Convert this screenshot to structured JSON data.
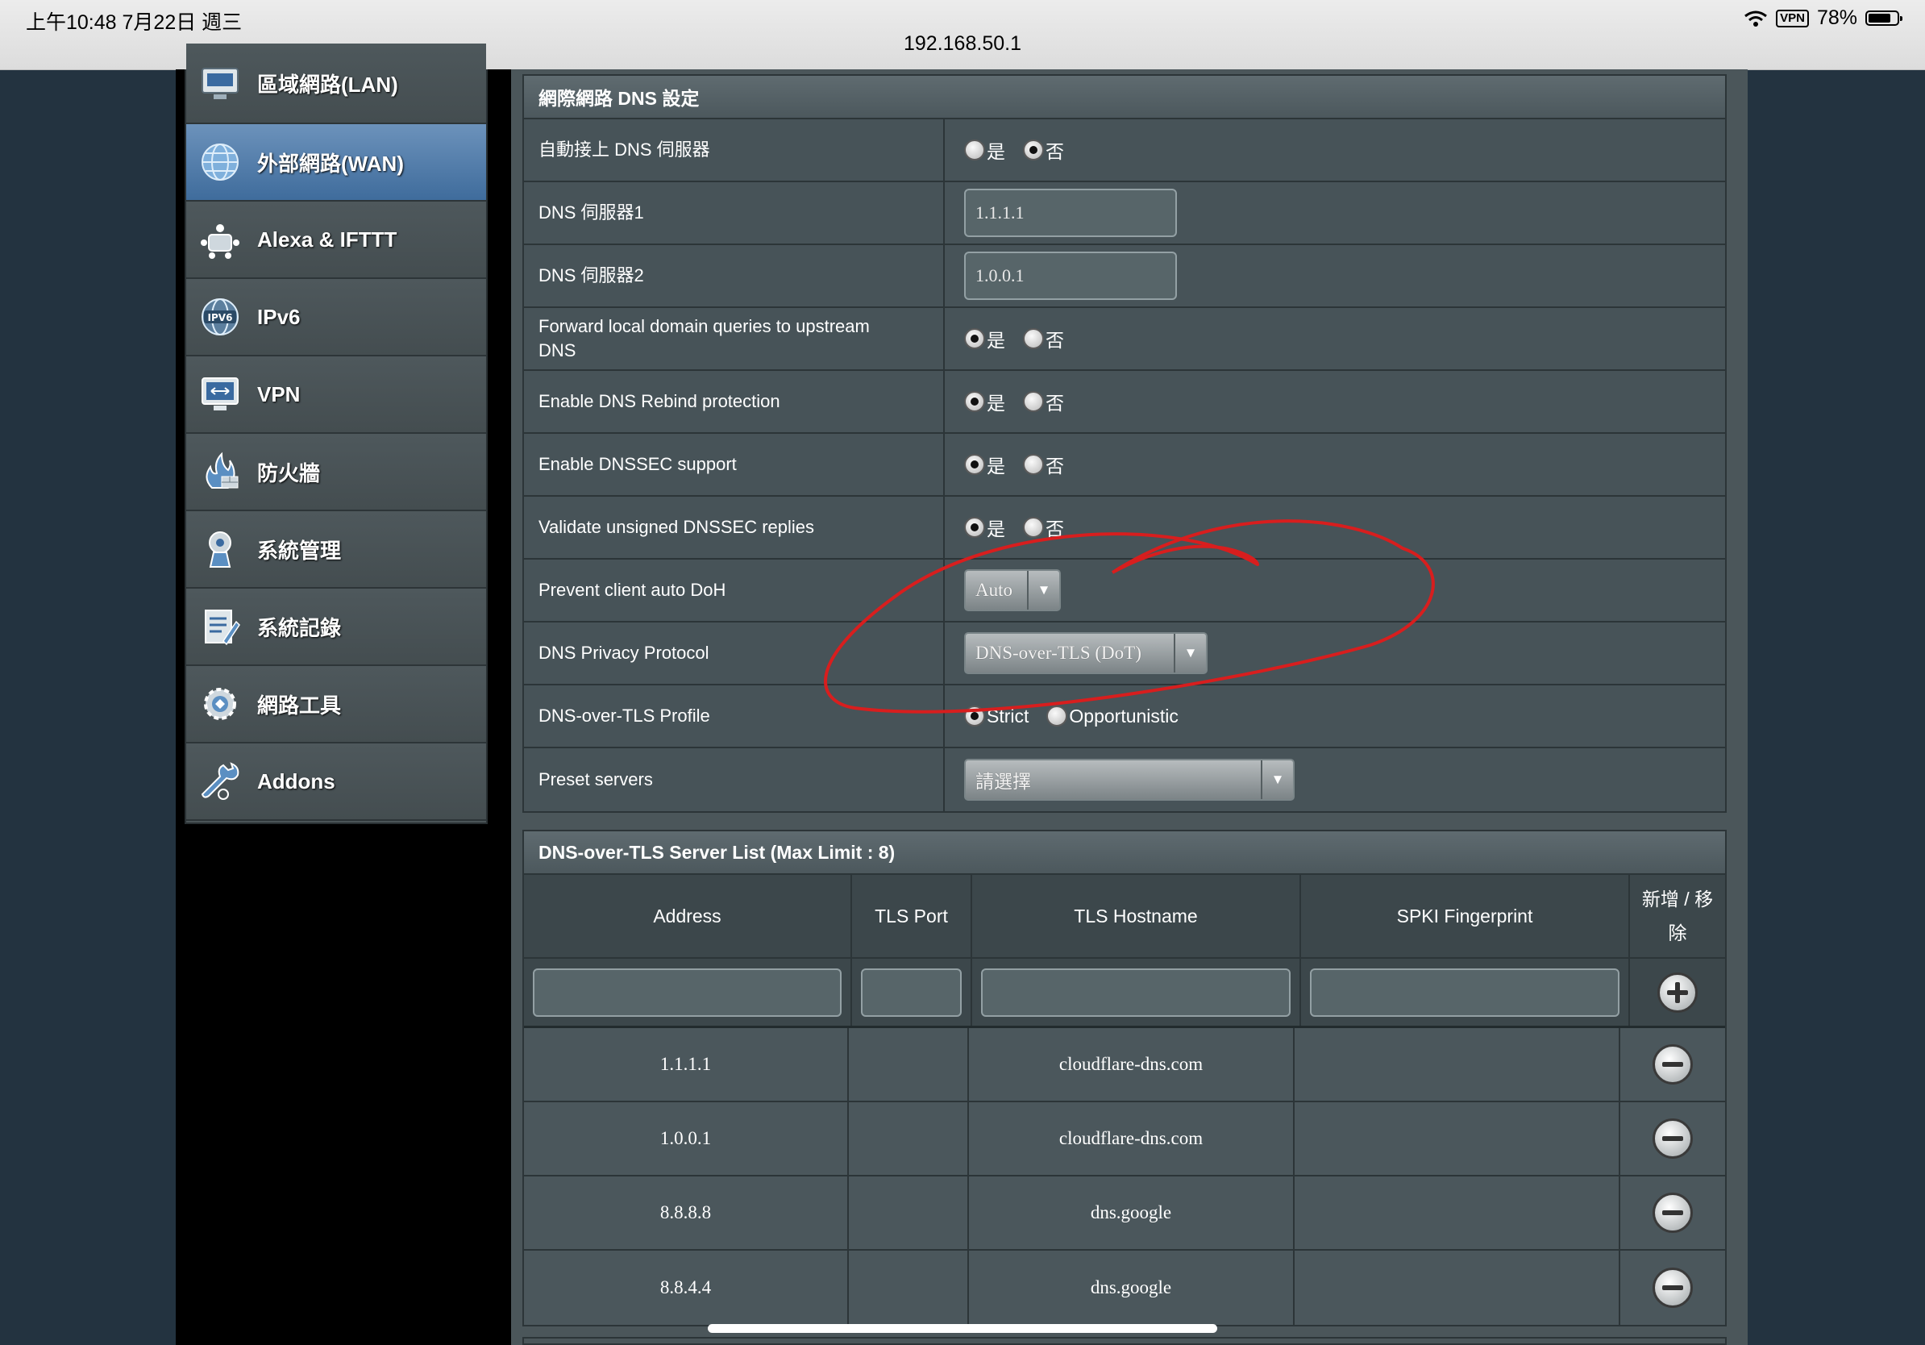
{
  "status_bar": {
    "time": "上午10:48   7月22日 週三",
    "url": "192.168.50.1",
    "vpn": "VPN",
    "battery": "78%",
    "battery_level": 0.78
  },
  "sidebar": {
    "items": [
      {
        "label": "區域網路(LAN)",
        "icon": "lan-icon"
      },
      {
        "label": "外部網路(WAN)",
        "icon": "globe-icon",
        "active": true
      },
      {
        "label": "Alexa & IFTTT",
        "icon": "smart-home-icon"
      },
      {
        "label": "IPv6",
        "icon": "ipv6-globe-icon"
      },
      {
        "label": "VPN",
        "icon": "vpn-monitor-icon"
      },
      {
        "label": "防火牆",
        "icon": "firewall-icon"
      },
      {
        "label": "系統管理",
        "icon": "admin-gear-icon"
      },
      {
        "label": "系統記錄",
        "icon": "log-icon"
      },
      {
        "label": "網路工具",
        "icon": "network-tools-icon"
      },
      {
        "label": "Addons",
        "icon": "wrench-icon"
      }
    ]
  },
  "dns_settings": {
    "header": "網際網路 DNS 設定",
    "yes": "是",
    "no": "否",
    "rows": {
      "auto_dns": {
        "label": "自動接上 DNS 伺服器",
        "selected": "no"
      },
      "dns1": {
        "label": "DNS 伺服器1",
        "value": "1.1.1.1"
      },
      "dns2": {
        "label": "DNS 伺服器2",
        "value": "1.0.0.1"
      },
      "forward_local": {
        "label": "Forward local domain queries to upstream DNS",
        "selected": "yes"
      },
      "rebind": {
        "label": "Enable DNS Rebind protection",
        "selected": "yes"
      },
      "dnssec": {
        "label": "Enable DNSSEC support",
        "selected": "yes"
      },
      "validate_unsigned": {
        "label": "Validate unsigned DNSSEC replies",
        "selected": "yes"
      },
      "prevent_doh": {
        "label": "Prevent client auto DoH",
        "value": "Auto"
      },
      "privacy_protocol": {
        "label": "DNS Privacy Protocol",
        "value": "DNS-over-TLS (DoT)"
      },
      "dot_profile": {
        "label": "DNS-over-TLS Profile",
        "option_strict": "Strict",
        "option_opportunistic": "Opportunistic",
        "selected": "strict"
      },
      "preset_servers": {
        "label": "Preset servers",
        "value": "請選擇"
      }
    }
  },
  "dot_list": {
    "header": "DNS-over-TLS Server List (Max Limit : 8)",
    "columns": [
      "Address",
      "TLS Port",
      "TLS Hostname",
      "SPKI Fingerprint",
      "新增 / 移除"
    ],
    "rows": [
      {
        "address": "1.1.1.1",
        "port": "",
        "hostname": "cloudflare-dns.com",
        "spki": ""
      },
      {
        "address": "1.0.0.1",
        "port": "",
        "hostname": "cloudflare-dns.com",
        "spki": ""
      },
      {
        "address": "8.8.8.8",
        "port": "",
        "hostname": "dns.google",
        "spki": ""
      },
      {
        "address": "8.8.4.4",
        "port": "",
        "hostname": "dns.google",
        "spki": ""
      }
    ]
  },
  "colors": {
    "annotation": "#d81e1e",
    "active_nav": "#4f7ba8"
  }
}
